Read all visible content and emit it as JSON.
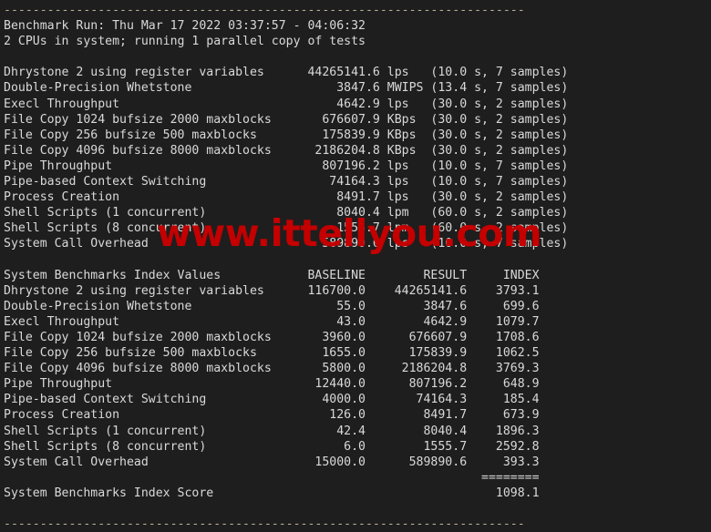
{
  "terminal": {
    "background_color": "#1e1e1e",
    "text_color": "#d9d9d9",
    "separator_color": "#b8b096",
    "top_separator": "------------------------------------------------------------------------",
    "bottom_separator": "------------------------------------------------------------------------",
    "benchmark_run_line": "Benchmark Run: Thu Mar 17 2022 03:37:57 - 04:06:32",
    "cpu_line": "2 CPUs in system; running 1 parallel copy of tests",
    "results": [
      {
        "name": "Dhrystone 2 using register variables",
        "value": "44265141.6",
        "unit": "lps",
        "timing": "(10.0 s, 7 samples)"
      },
      {
        "name": "Double-Precision Whetstone",
        "value": "3847.6",
        "unit": "MWIPS",
        "timing": "(13.4 s, 7 samples)"
      },
      {
        "name": "Execl Throughput",
        "value": "4642.9",
        "unit": "lps",
        "timing": "(30.0 s, 2 samples)"
      },
      {
        "name": "File Copy 1024 bufsize 2000 maxblocks",
        "value": "676607.9",
        "unit": "KBps",
        "timing": "(30.0 s, 2 samples)"
      },
      {
        "name": "File Copy 256 bufsize 500 maxblocks",
        "value": "175839.9",
        "unit": "KBps",
        "timing": "(30.0 s, 2 samples)"
      },
      {
        "name": "File Copy 4096 bufsize 8000 maxblocks",
        "value": "2186204.8",
        "unit": "KBps",
        "timing": "(30.0 s, 2 samples)"
      },
      {
        "name": "Pipe Throughput",
        "value": "807196.2",
        "unit": "lps",
        "timing": "(10.0 s, 7 samples)"
      },
      {
        "name": "Pipe-based Context Switching",
        "value": "74164.3",
        "unit": "lps",
        "timing": "(10.0 s, 7 samples)"
      },
      {
        "name": "Process Creation",
        "value": "8491.7",
        "unit": "lps",
        "timing": "(30.0 s, 2 samples)"
      },
      {
        "name": "Shell Scripts (1 concurrent)",
        "value": "8040.4",
        "unit": "lpm",
        "timing": "(60.0 s, 2 samples)"
      },
      {
        "name": "Shell Scripts (8 concurrent)",
        "value": "1555.7",
        "unit": "lpm",
        "timing": "(60.0 s, 2 samples)"
      },
      {
        "name": "System Call Overhead",
        "value": "589890.6",
        "unit": "lps",
        "timing": "(10.0 s, 7 samples)"
      }
    ],
    "index_title": "System Benchmarks Index Values",
    "index_columns": [
      "BASELINE",
      "RESULT",
      "INDEX"
    ],
    "index_rows": [
      {
        "name": "Dhrystone 2 using register variables",
        "baseline": "116700.0",
        "result": "44265141.6",
        "index": "3793.1"
      },
      {
        "name": "Double-Precision Whetstone",
        "baseline": "55.0",
        "result": "3847.6",
        "index": "699.6"
      },
      {
        "name": "Execl Throughput",
        "baseline": "43.0",
        "result": "4642.9",
        "index": "1079.7"
      },
      {
        "name": "File Copy 1024 bufsize 2000 maxblocks",
        "baseline": "3960.0",
        "result": "676607.9",
        "index": "1708.6"
      },
      {
        "name": "File Copy 256 bufsize 500 maxblocks",
        "baseline": "1655.0",
        "result": "175839.9",
        "index": "1062.5"
      },
      {
        "name": "File Copy 4096 bufsize 8000 maxblocks",
        "baseline": "5800.0",
        "result": "2186204.8",
        "index": "3769.3"
      },
      {
        "name": "Pipe Throughput",
        "baseline": "12440.0",
        "result": "807196.2",
        "index": "648.9"
      },
      {
        "name": "Pipe-based Context Switching",
        "baseline": "4000.0",
        "result": "74164.3",
        "index": "185.4"
      },
      {
        "name": "Process Creation",
        "baseline": "126.0",
        "result": "8491.7",
        "index": "673.9"
      },
      {
        "name": "Shell Scripts (1 concurrent)",
        "baseline": "42.4",
        "result": "8040.4",
        "index": "1896.3"
      },
      {
        "name": "Shell Scripts (8 concurrent)",
        "baseline": "6.0",
        "result": "1555.7",
        "index": "2592.8"
      },
      {
        "name": "System Call Overhead",
        "baseline": "15000.0",
        "result": "589890.6",
        "index": "393.3"
      }
    ],
    "score_rule": "========",
    "score_label": "System Benchmarks Index Score",
    "score_value": "1098.1"
  },
  "watermark": {
    "text": "www.ittellyou.com",
    "color": "#c40000"
  }
}
